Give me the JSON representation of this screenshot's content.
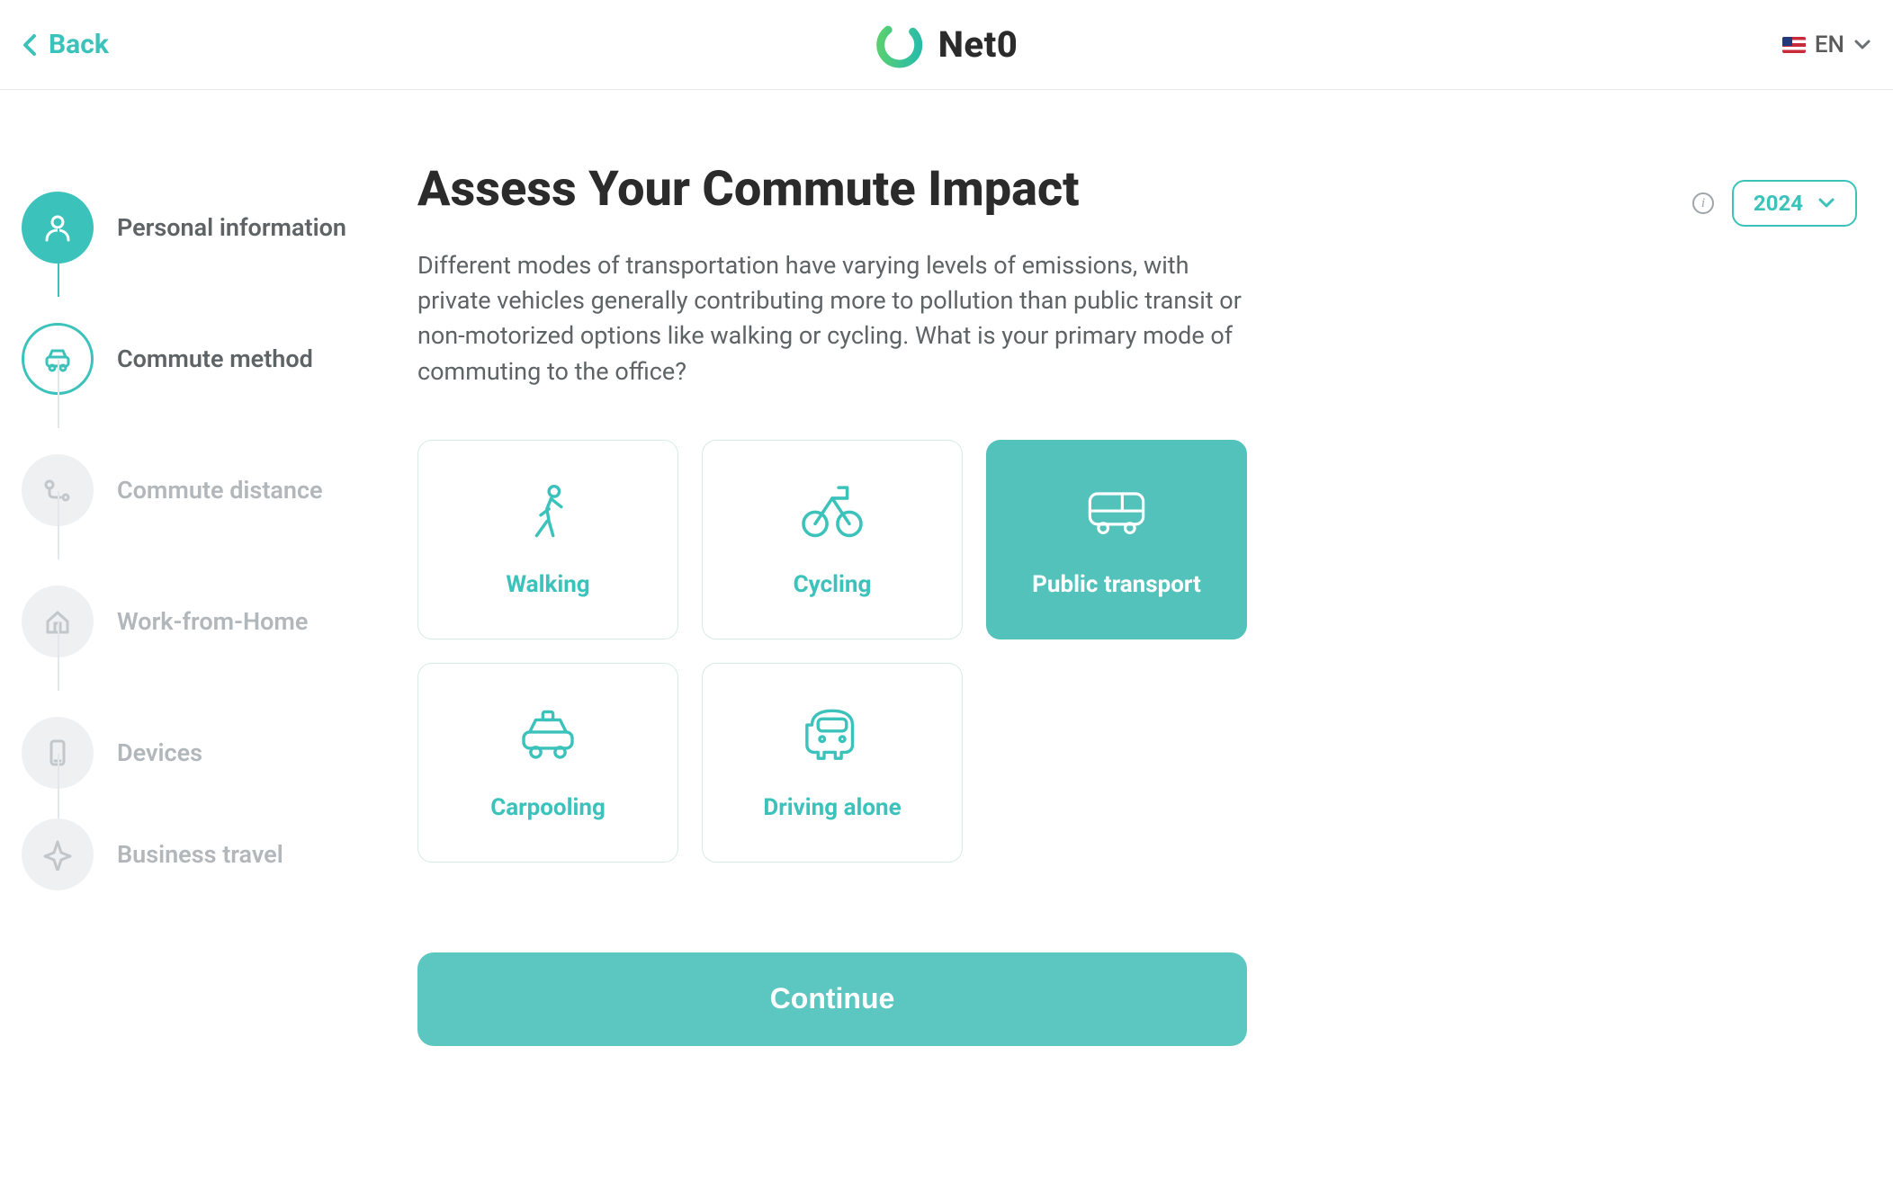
{
  "header": {
    "back_label": "Back",
    "brand_name": "Net0",
    "language_code": "EN"
  },
  "year_selector": {
    "value": "2024"
  },
  "stepper": {
    "steps": [
      {
        "label": "Personal information",
        "state": "done",
        "icon": "user"
      },
      {
        "label": "Commute method",
        "state": "current",
        "icon": "car"
      },
      {
        "label": "Commute distance",
        "state": "future",
        "icon": "route"
      },
      {
        "label": "Work-from-Home",
        "state": "future",
        "icon": "home"
      },
      {
        "label": "Devices",
        "state": "future",
        "icon": "phone"
      },
      {
        "label": "Business travel",
        "state": "future",
        "icon": "plane"
      }
    ]
  },
  "main": {
    "title": "Assess Your Commute Impact",
    "description": "Different modes of transportation have varying levels of emissions, with private vehicles generally contributing more to pollution than public transit or non-motorized options like walking or cycling. What is your primary mode of commuting to the office?",
    "options": [
      {
        "label": "Walking",
        "icon": "walk",
        "selected": false
      },
      {
        "label": "Cycling",
        "icon": "bike",
        "selected": false
      },
      {
        "label": "Public transport",
        "icon": "bus",
        "selected": true
      },
      {
        "label": "Carpooling",
        "icon": "taxi",
        "selected": false
      },
      {
        "label": "Driving alone",
        "icon": "car-front",
        "selected": false
      }
    ],
    "continue_label": "Continue"
  }
}
